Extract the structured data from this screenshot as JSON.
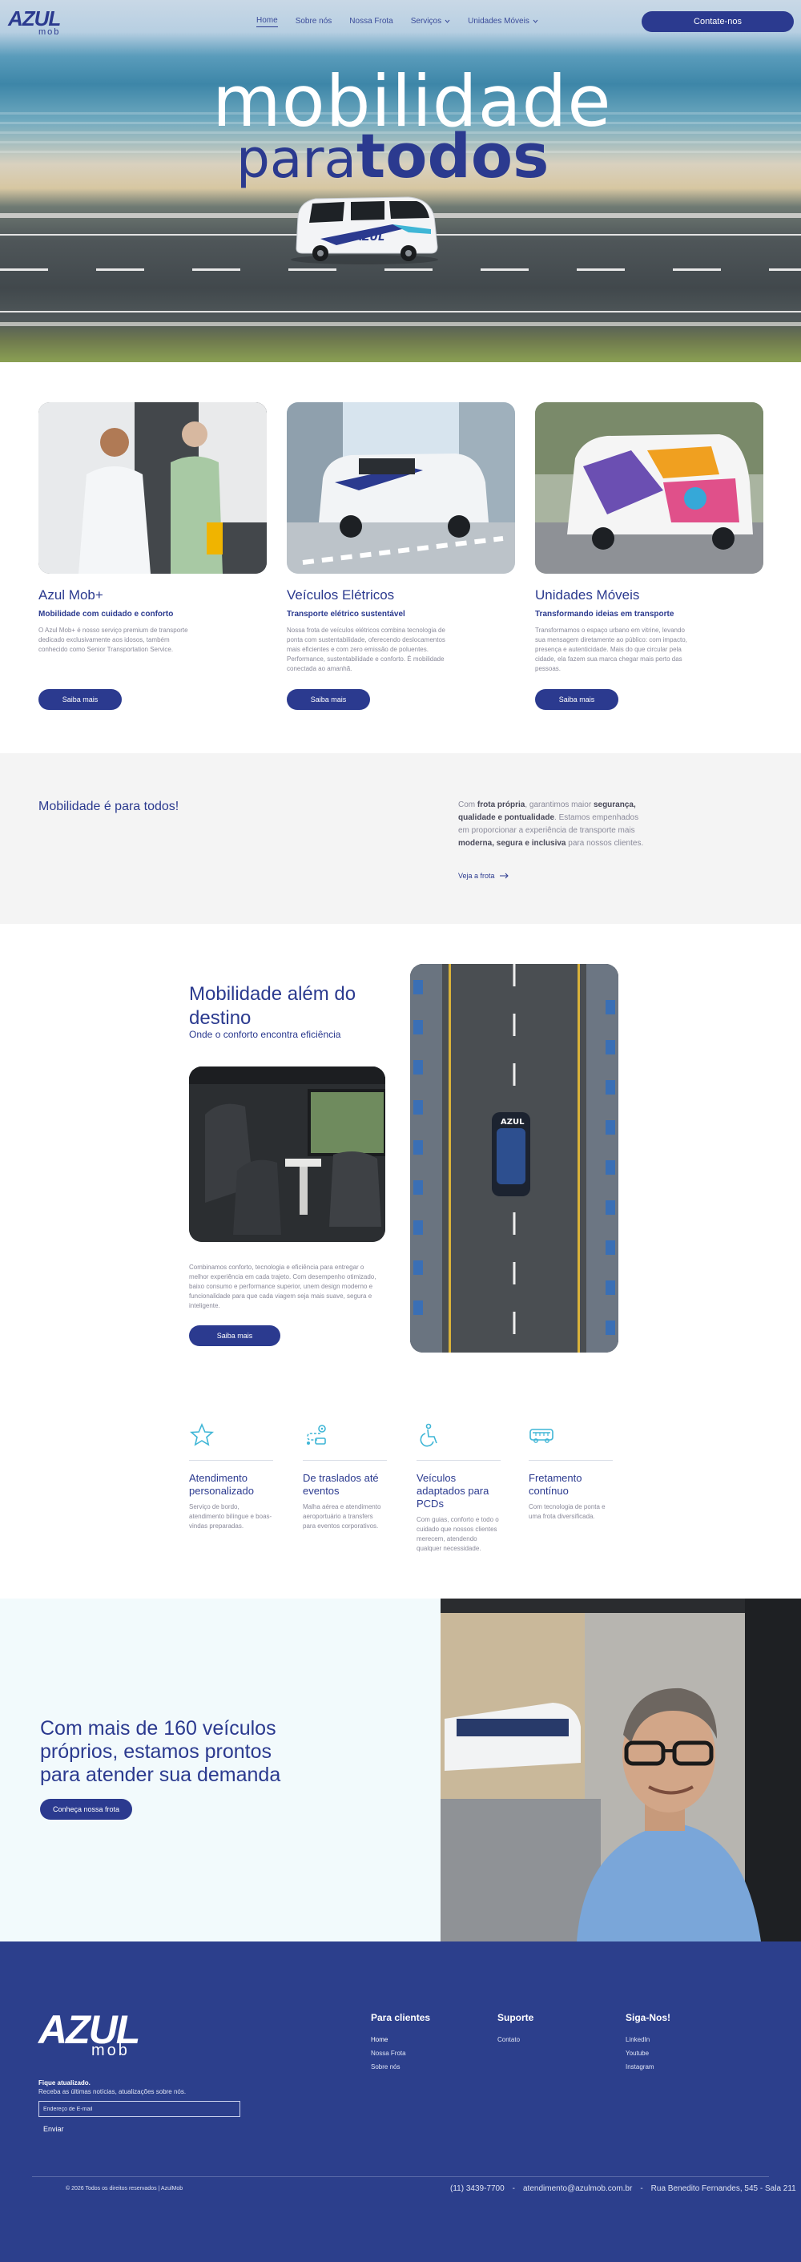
{
  "brand": {
    "logo_main": "AZUL",
    "logo_sub": "mob"
  },
  "nav": {
    "items": [
      {
        "label": "Home",
        "active": true
      },
      {
        "label": "Sobre nós",
        "active": false
      },
      {
        "label": "Nossa Frota",
        "active": false
      },
      {
        "label": "Serviços",
        "dropdown": true
      },
      {
        "label": "Unidades Móveis",
        "dropdown": true
      }
    ],
    "cta": "Contate-nos"
  },
  "hero": {
    "title_line1": "mobilidade",
    "title_line2a": "para",
    "title_line2b": "todos",
    "van_label": "AZUL"
  },
  "cards": [
    {
      "title": "Azul Mob+",
      "subtitle": "Mobilidade com cuidado e conforto",
      "description": "O Azul Mob+ é nosso serviço premium de transporte dedicado exclusivamente aos idosos, também conhecido como Senior Transportation Service.",
      "button": "Saiba mais"
    },
    {
      "title": "Veículos Elétricos",
      "subtitle": "Transporte elétrico sustentável",
      "description": "Nossa frota de veículos elétricos combina tecnologia de ponta com sustentabilidade, oferecendo deslocamentos mais eficientes e com zero emissão de poluentes. Performance, sustentabilidade e conforto. É mobilidade conectada ao amanhã.",
      "button": "Saiba mais"
    },
    {
      "title": "Unidades Móveis",
      "subtitle": "Transformando ideias em transporte",
      "description": "Transformamos o espaço urbano em vitrine, levando sua mensagem diretamente ao público: com impacto, presença e autenticidade. Mais do que circular pela cidade, ela fazem sua marca chegar mais perto das pessoas.",
      "button": "Saiba mais"
    }
  ],
  "band": {
    "title": "Mobilidade é para todos!",
    "text_parts": [
      "Com ",
      "frota própria",
      ", garantimos maior ",
      "segurança, qualidade e pontualidade",
      ". Estamos empenhados em proporcionar a experiência de transporte mais ",
      "moderna, segura e inclusiva",
      " para nossos clientes."
    ],
    "link": "Veja a frota"
  },
  "beyond": {
    "title": "Mobilidade além do destino",
    "subtitle": "Onde o conforto encontra eficiência",
    "description": "Combinamos conforto, tecnologia e eficiência para entregar o melhor experiência em cada trajeto. Com desempenho otimizado, baixo consumo e performance superior, unem design moderno e funcionalidade para que cada viagem seja mais suave, segura e inteligente.",
    "button": "Saiba mais",
    "aerial_van_label": "AZUL"
  },
  "features": [
    {
      "icon": "star-icon",
      "title": "Atendimento personalizado",
      "description": "Serviço de bordo, atendimento bilíngue e boas-vindas preparadas."
    },
    {
      "icon": "transfer-route-icon",
      "title": "De traslados até eventos",
      "description": "Malha aérea e atendimento aeroportuário a transfers para eventos corporativos."
    },
    {
      "icon": "wheelchair-icon",
      "title": "Veículos adaptados para PCDs",
      "description": "Com guias, conforto e todo o cuidado que nossos clientes merecem, atendendo qualquer necessidade."
    },
    {
      "icon": "bus-icon",
      "title": "Fretamento contínuo",
      "description": "Com tecnologia de ponta e uma frota diversificada."
    }
  ],
  "fleet": {
    "title": "Com mais de 160 veículos próprios, estamos prontos para atender sua demanda",
    "button": "Conheça nossa frota"
  },
  "footer": {
    "stay_title": "Fique atualizado.",
    "stay_text": "Receba as últimas notícias, atualizações sobre nós.",
    "email_placeholder": "Endereço de E-mail",
    "send": "Enviar",
    "columns": [
      {
        "title": "Para clientes",
        "links": [
          "Home",
          "Nossa Frota",
          "Sobre nós"
        ]
      },
      {
        "title": "Suporte",
        "links": [
          "Contato"
        ]
      },
      {
        "title": "Siga-Nos!",
        "links": [
          "LinkedIn",
          "Youtube",
          "Instagram"
        ]
      }
    ],
    "copyright": "© 2026 Todos os direitos reservados | AzulMob",
    "phone": "(11) 3439-7700",
    "email": "atendimento@azulmob.com.br",
    "address": "Rua Benedito Fernandes, 545 - Sala 211",
    "separator": "-"
  },
  "colors": {
    "brand": "#2b3a8f",
    "accent": "#3fb6d6",
    "footer_bg": "#2c3f8c",
    "band_bg": "#f4f4f4",
    "fleet_bg": "#f2fafc"
  }
}
